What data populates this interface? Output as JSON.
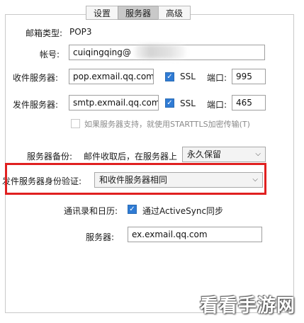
{
  "tabs": [
    {
      "label": "设置",
      "active": false
    },
    {
      "label": "服务器",
      "active": true
    },
    {
      "label": "高级",
      "active": false
    }
  ],
  "mailbox_type": {
    "label": "邮箱类型:",
    "value": "POP3"
  },
  "account": {
    "label": "帐号:",
    "value": "cuiqingqing@"
  },
  "incoming": {
    "label": "收件服务器:",
    "value": "pop.exmail.qq.com",
    "ssl_label": "SSL",
    "ssl_checked": true,
    "port_label": "端口:",
    "port": "995"
  },
  "outgoing": {
    "label": "发件服务器:",
    "value": "smtp.exmail.qq.com",
    "ssl_label": "SSL",
    "ssl_checked": true,
    "port_label": "端口:",
    "port": "465"
  },
  "starttls": {
    "label": "如果服务器支持，就使用STARTTLS加密传输(T)",
    "checked": false
  },
  "backup": {
    "label": "服务器备份:",
    "middle": "邮件收取后，在服务器上",
    "selected": "永久保留"
  },
  "auth": {
    "label": "发件服务器身份验证:",
    "selected": "和收件服务器相同"
  },
  "contacts": {
    "label": "通讯录和日历:",
    "checkbox_label": "通过ActiveSync同步",
    "checked": true
  },
  "activesync_server": {
    "label": "服务器:",
    "value": "ex.exmail.qq.com"
  },
  "watermark": "看看手游网",
  "colors": {
    "highlight": "#e02020",
    "check": "#2f7bd4"
  }
}
